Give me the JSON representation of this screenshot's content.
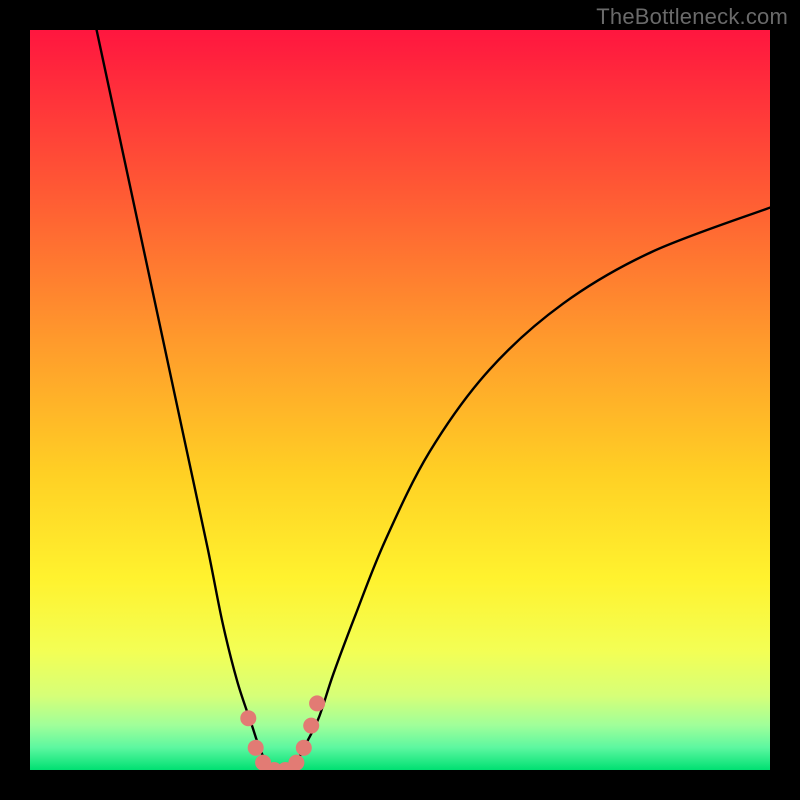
{
  "watermark": "TheBottleneck.com",
  "chart_data": {
    "type": "line",
    "title": "",
    "xlabel": "",
    "ylabel": "",
    "xlim": [
      0,
      100
    ],
    "ylim": [
      0,
      100
    ],
    "grid": false,
    "legend": false,
    "gradient_colors": {
      "top": "#ff163f",
      "upper_mid": "#ff8b2e",
      "mid": "#ffe625",
      "lower_mid": "#f7ff55",
      "near_bottom": "#b9ff8d",
      "bottom": "#00e072"
    },
    "series": [
      {
        "name": "bottleneck-curve",
        "x": [
          9,
          12,
          15,
          18,
          21,
          24,
          26,
          28,
          30,
          31,
          32,
          33,
          34,
          35,
          36,
          37,
          39,
          41,
          44,
          48,
          54,
          62,
          72,
          84,
          100
        ],
        "y": [
          100,
          86,
          72,
          58,
          44,
          30,
          20,
          12,
          6,
          3,
          1,
          0,
          0,
          0,
          1,
          3,
          7,
          13,
          21,
          31,
          43,
          54,
          63,
          70,
          76
        ]
      },
      {
        "name": "bottom-markers",
        "x": [
          29.5,
          30.5,
          31.5,
          33,
          34.5,
          36,
          37,
          38,
          38.8
        ],
        "y": [
          7,
          3,
          1,
          0,
          0,
          1,
          3,
          6,
          9
        ]
      }
    ],
    "marker_color": "#e27b74",
    "curve_color": "#000000"
  }
}
